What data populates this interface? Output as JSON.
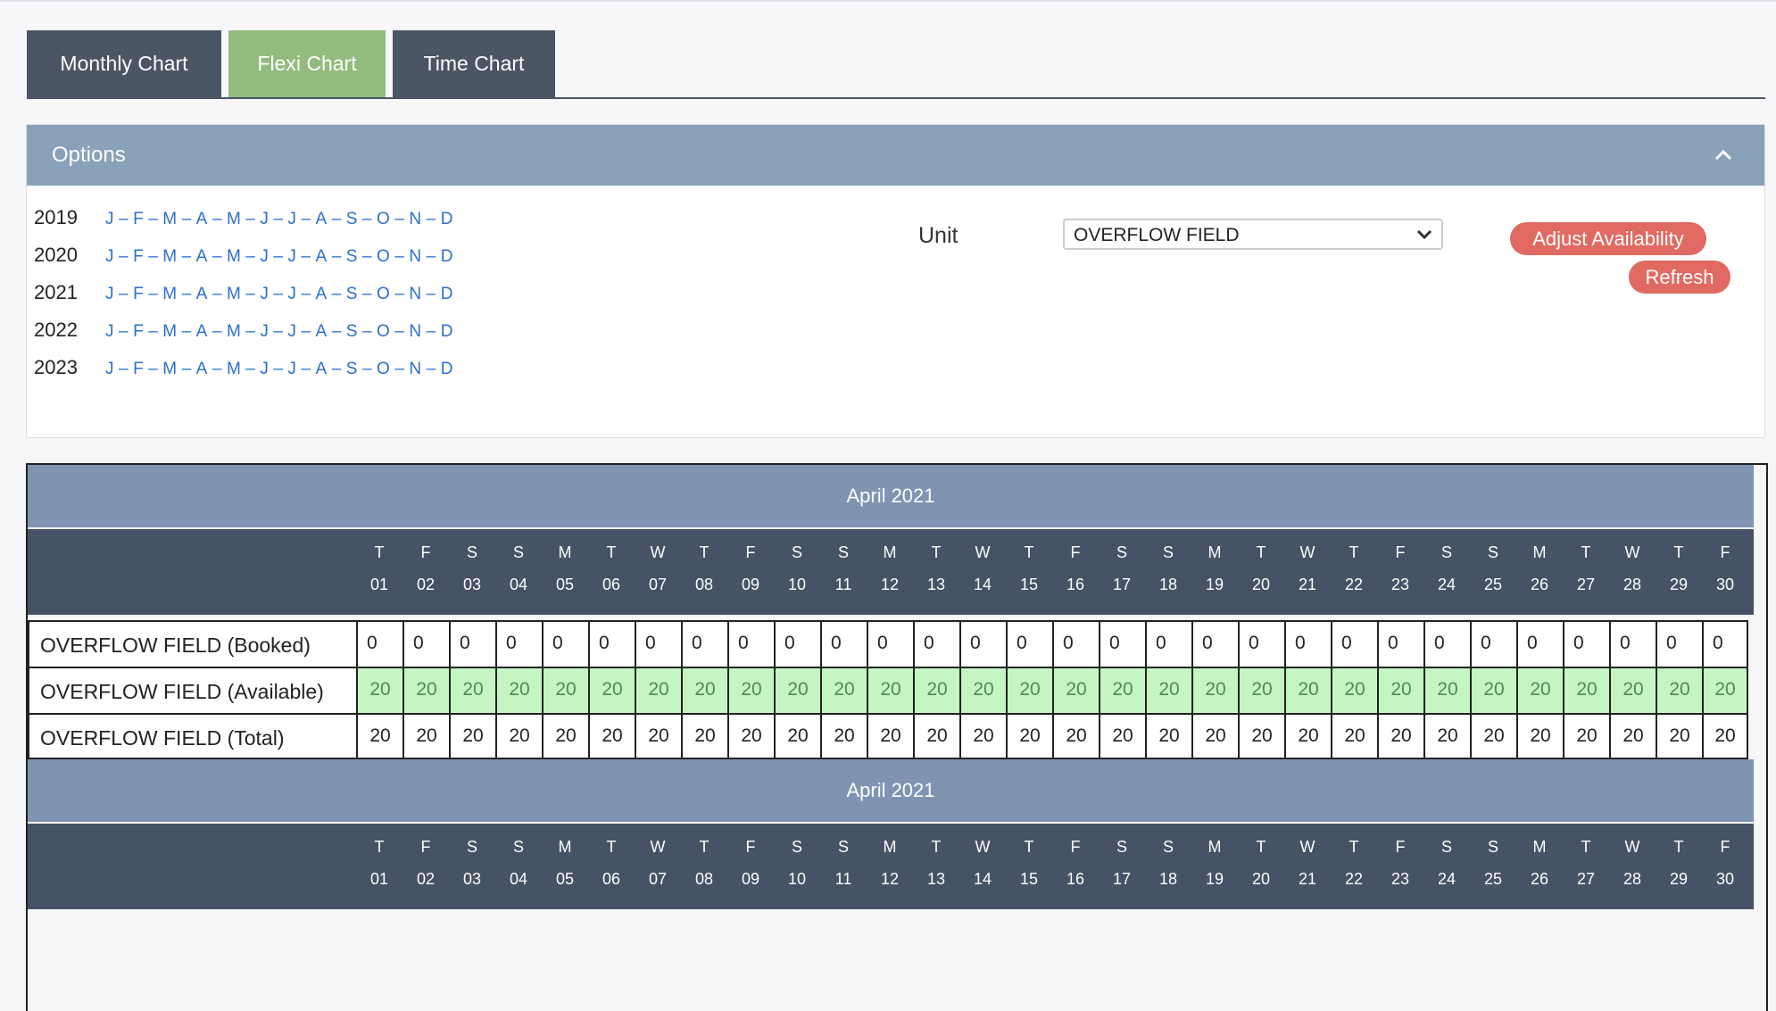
{
  "tabs": [
    {
      "label": "Monthly Chart",
      "active": false
    },
    {
      "label": "Flexi Chart",
      "active": true
    },
    {
      "label": "Time Chart",
      "active": false
    }
  ],
  "options": {
    "title": "Options",
    "collapse_icon": "chevron-up-icon",
    "month_letters": [
      "J",
      "F",
      "M",
      "A",
      "M",
      "J",
      "J",
      "A",
      "S",
      "O",
      "N",
      "D"
    ],
    "separator": "–",
    "years": [
      "2019",
      "2020",
      "2021",
      "2022",
      "2023"
    ],
    "unit_label": "Unit",
    "unit_select_value": "OVERFLOW FIELD",
    "adjust_button": "Adjust Availability",
    "refresh_button": "Refresh"
  },
  "colors": {
    "tab_bg": "#4a5566",
    "tab_active_bg": "#93bb7e",
    "options_header_bg": "#8aa1ba",
    "month_banner_bg": "#7e94b2",
    "day_header_bg": "#465265",
    "available_cell_bg": "#c6f5c4",
    "available_text": "#4b8c54",
    "button_red": "#e06a62",
    "link_blue": "#2a6fd0"
  },
  "chart": {
    "month_title": "April 2021",
    "days_of_week": [
      "T",
      "F",
      "S",
      "S",
      "M",
      "T",
      "W",
      "T",
      "F",
      "S",
      "S",
      "M",
      "T",
      "W",
      "T",
      "F",
      "S",
      "S",
      "M",
      "T",
      "W",
      "T",
      "F",
      "S",
      "S",
      "M",
      "T",
      "W",
      "T",
      "F"
    ],
    "day_numbers": [
      "01",
      "02",
      "03",
      "04",
      "05",
      "06",
      "07",
      "08",
      "09",
      "10",
      "11",
      "12",
      "13",
      "14",
      "15",
      "16",
      "17",
      "18",
      "19",
      "20",
      "21",
      "22",
      "23",
      "24",
      "25",
      "26",
      "27",
      "28",
      "29",
      "30"
    ],
    "rows": [
      {
        "label": "OVERFLOW FIELD (Booked)",
        "kind": "booked",
        "values": [
          0,
          0,
          0,
          0,
          0,
          0,
          0,
          0,
          0,
          0,
          0,
          0,
          0,
          0,
          0,
          0,
          0,
          0,
          0,
          0,
          0,
          0,
          0,
          0,
          0,
          0,
          0,
          0,
          0,
          0
        ]
      },
      {
        "label": "OVERFLOW FIELD (Available)",
        "kind": "avail",
        "values": [
          20,
          20,
          20,
          20,
          20,
          20,
          20,
          20,
          20,
          20,
          20,
          20,
          20,
          20,
          20,
          20,
          20,
          20,
          20,
          20,
          20,
          20,
          20,
          20,
          20,
          20,
          20,
          20,
          20,
          20
        ]
      },
      {
        "label": "OVERFLOW FIELD (Total)",
        "kind": "total",
        "values": [
          20,
          20,
          20,
          20,
          20,
          20,
          20,
          20,
          20,
          20,
          20,
          20,
          20,
          20,
          20,
          20,
          20,
          20,
          20,
          20,
          20,
          20,
          20,
          20,
          20,
          20,
          20,
          20,
          20,
          20
        ]
      }
    ],
    "second_month_title": "April 2021"
  }
}
